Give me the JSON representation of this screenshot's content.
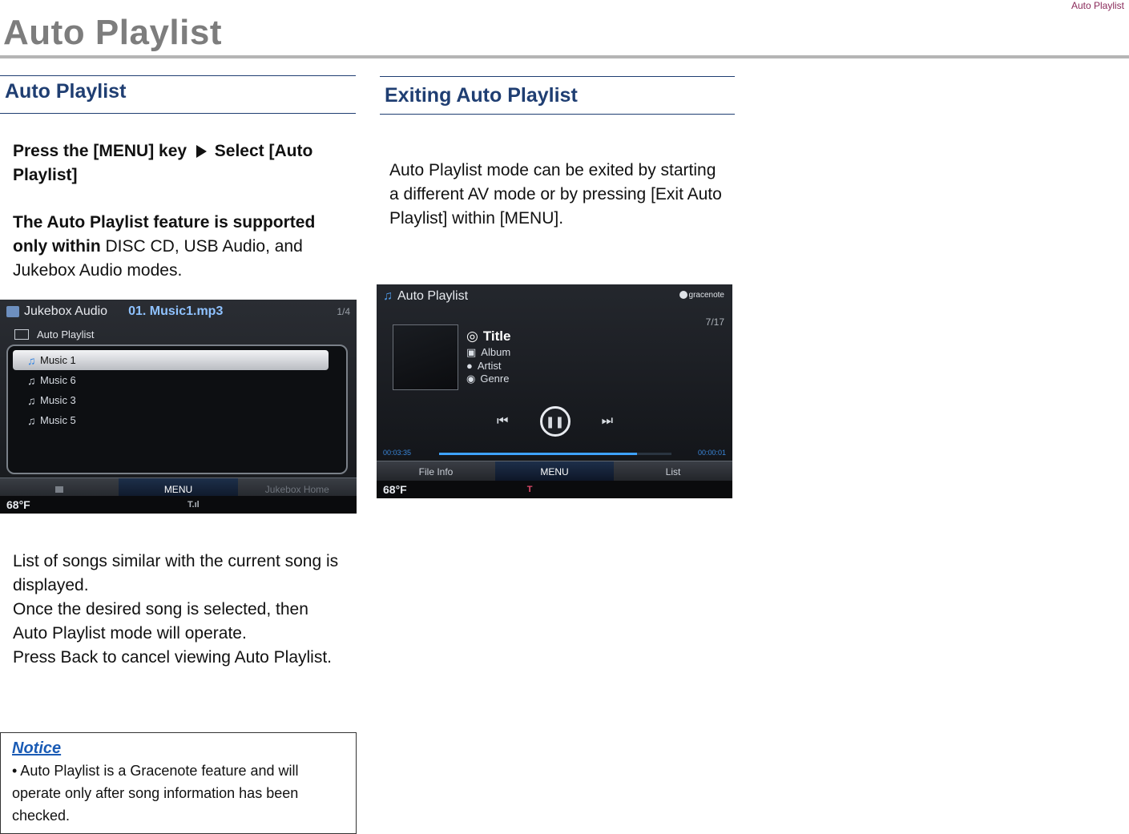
{
  "header": {
    "running_head": "Auto Playlist",
    "title": "Auto Playlist"
  },
  "left": {
    "section_title": "Auto Playlist",
    "step": {
      "part1": "Press the [MENU] key",
      "part2": "Select [Auto Playlist]"
    },
    "support": {
      "bold": "The Auto Playlist feature is supported only within",
      "normal": " DISC CD, USB Audio, and Jukebox Audio modes."
    },
    "description": [
      "List of songs similar with the current song is displayed.",
      "Once the desired song is selected, then Auto Playlist mode will operate.",
      "Press Back to cancel viewing Auto Playlist."
    ],
    "notice": {
      "title": "Notice",
      "body": "• Auto Playlist is a Gracenote feature and will operate only after song information has been checked."
    }
  },
  "right": {
    "section_title": "Exiting Auto Playlist",
    "body": "Auto Playlist mode can be exited by starting a different AV mode or by pressing [Exit Auto Playlist] within [MENU]."
  },
  "screen_jukebox": {
    "mode": "Jukebox Audio",
    "track": "01. Music1.mp3",
    "page": "1/4",
    "folder": "Auto Playlist",
    "songs": [
      "Music 1",
      "Music 6",
      "Music 3",
      "Music 5"
    ],
    "tabs": [
      "",
      "MENU",
      "Jukebox Home"
    ],
    "temp": "68°F",
    "signal": "T.ıl"
  },
  "screen_autoplaylist": {
    "title": "Auto Playlist",
    "logo": "gracenote",
    "count": "7/17",
    "meta": {
      "title": "Title",
      "album": "Album",
      "artist": "Artist",
      "genre": "Genre"
    },
    "time_start": "00:03:35",
    "time_end": "00:00:01",
    "progress": 0.85,
    "tabs": [
      "File Info",
      "MENU",
      "List"
    ],
    "temp": "68°F",
    "signal": "T"
  }
}
